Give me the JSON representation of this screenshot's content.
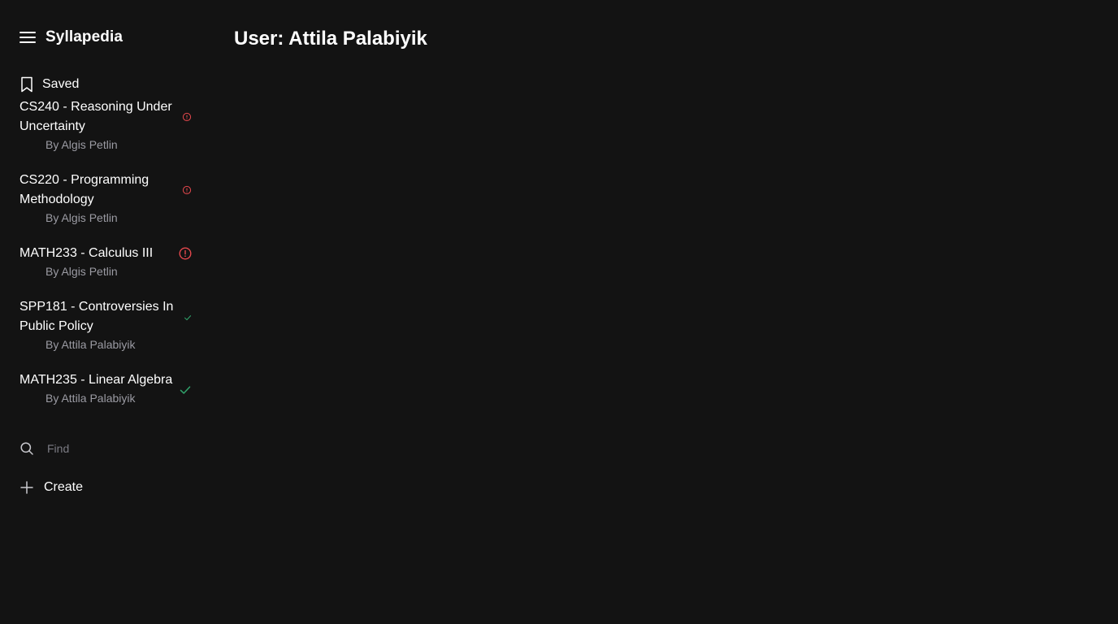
{
  "sidebar": {
    "brand": "Syllapedia",
    "saved_label": "Saved",
    "courses": [
      {
        "title": "CS240 - Reasoning Under Uncertainty",
        "author": "By Algis Petlin",
        "status": "warning",
        "status_color": "#e5484d"
      },
      {
        "title": "CS220 - Programming Methodology",
        "author": "By Algis Petlin",
        "status": "warning",
        "status_color": "#e5484d"
      },
      {
        "title": "MATH233 - Calculus III",
        "author": "By Algis Petlin",
        "status": "warning",
        "status_color": "#e5484d"
      },
      {
        "title": "SPP181 - Controversies In Public Policy",
        "author": "By Attila Palabiyik",
        "status": "check",
        "status_color": "#30a46c"
      },
      {
        "title": "MATH235 - Linear Algebra",
        "author": "By Attila Palabiyik",
        "status": "check",
        "status_color": "#30a46c"
      }
    ],
    "find_placeholder": "Find",
    "create_label": "Create"
  },
  "main": {
    "title": "User: Attila Palabiyik"
  },
  "colors": {
    "background": "#131313",
    "text": "#ffffff",
    "muted": "#9b9ba3",
    "warning": "#e5484d",
    "success": "#30a46c"
  }
}
